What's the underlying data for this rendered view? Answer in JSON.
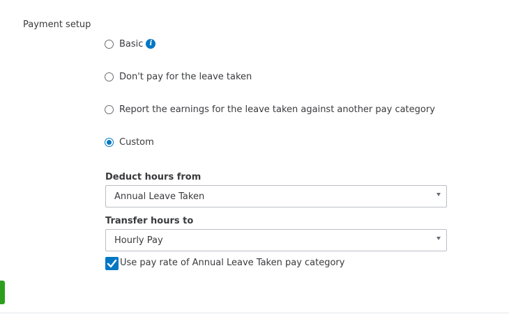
{
  "section": {
    "title": "Payment setup"
  },
  "payment_options": [
    {
      "label": "Basic",
      "checked": false,
      "has_info_icon": true
    },
    {
      "label": "Don't pay for the leave taken",
      "checked": false
    },
    {
      "label": "Report the earnings for the leave taken against another pay category",
      "checked": false
    },
    {
      "label": "Custom",
      "checked": true
    }
  ],
  "deduct_hours": {
    "label": "Deduct hours from",
    "selected": "Annual Leave Taken"
  },
  "transfer_hours": {
    "label": "Transfer hours to",
    "selected": "Hourly Pay"
  },
  "use_pay_rate": {
    "label": "Use pay rate of Annual Leave Taken pay category",
    "checked": true
  },
  "colors": {
    "accent": "#0077c5",
    "green_tab": "#2ca01c",
    "text": "#393a3d"
  },
  "icons": {
    "info": "info-icon",
    "caret": "chevron-down-icon",
    "check": "checkmark-icon"
  }
}
